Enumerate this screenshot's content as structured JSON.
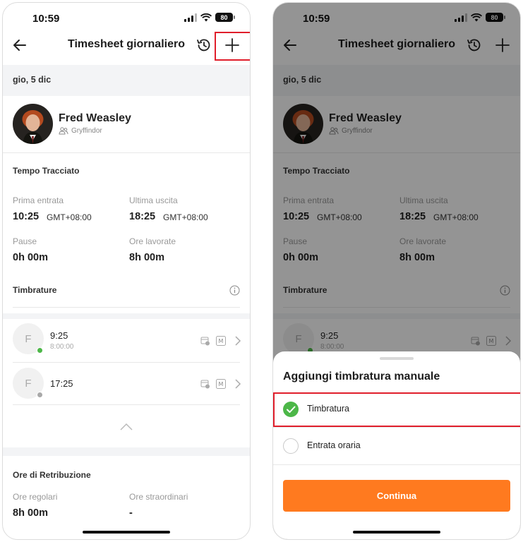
{
  "status_bar": {
    "time": "10:59",
    "battery": "80"
  },
  "header": {
    "title": "Timesheet giornaliero"
  },
  "date": "gio, 5 dic",
  "user": {
    "name": "Fred Weasley",
    "team": "Gryffindor"
  },
  "tracked": {
    "title": "Tempo Tracciato",
    "first_in_label": "Prima entrata",
    "first_in_time": "10:25",
    "first_in_tz": "GMT+08:00",
    "last_out_label": "Ultima uscita",
    "last_out_time": "18:25",
    "last_out_tz": "GMT+08:00",
    "breaks_label": "Pause",
    "breaks_value": "0h 00m",
    "worked_label": "Ore lavorate",
    "worked_value": "8h 00m"
  },
  "punches": {
    "title": "Timbrature",
    "items": [
      {
        "initial": "F",
        "time": "9:25",
        "sub": "8:00:00",
        "dot_color": "#4cb748",
        "badge": "M"
      },
      {
        "initial": "F",
        "time": "17:25",
        "sub": "",
        "dot_color": "#a9a9a9",
        "badge": "M"
      }
    ]
  },
  "pay": {
    "title": "Ore di Retribuzione",
    "regular_label": "Ore regolari",
    "regular_value": "8h 00m",
    "overtime_label": "Ore straordinari",
    "overtime_value": "-"
  },
  "sheet": {
    "title": "Aggiungi timbratura manuale",
    "options": [
      {
        "label": "Timbratura",
        "selected": true
      },
      {
        "label": "Entrata oraria",
        "selected": false
      }
    ],
    "continue_label": "Continua"
  },
  "colors": {
    "accent_orange": "#ff7a1f",
    "check_green": "#4cb748",
    "highlight_red": "#e01e2b"
  }
}
